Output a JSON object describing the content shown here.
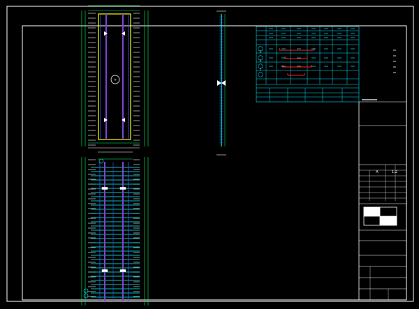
{
  "canvas": {
    "background": "#000000"
  },
  "colors": {
    "frame": "#ffffff",
    "rebar_cyan": "#00ffff",
    "rebar_blue": "#3a5cff",
    "rebar_purple": "#7b46d9",
    "outline_yellow": "#ffff00",
    "dim_green": "#00ff66",
    "stirrup_red": "#ff2020",
    "table_cyan": "#00e5ff"
  },
  "drawing": {
    "title_block": {
      "cross_section_marker": "A",
      "scale_label": "1:2"
    },
    "symbols": {
      "section_marker_a": "1",
      "section_marker_b": "1",
      "section_marker_c": "1",
      "center_marker": "+"
    }
  }
}
